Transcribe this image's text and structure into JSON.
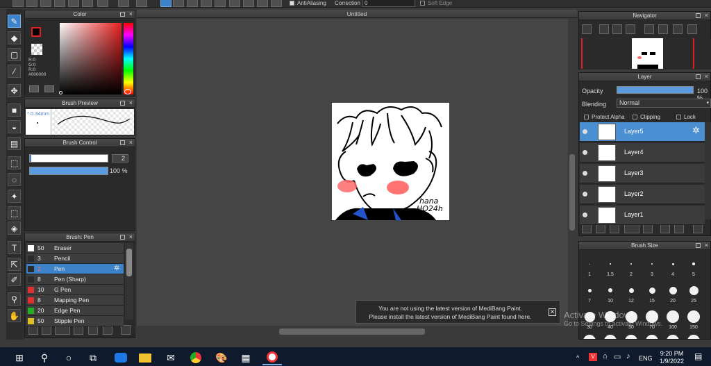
{
  "toolbar": {
    "antialiasing_label": "AntiAliasing",
    "correction_label": "Correction",
    "correction_value": "0",
    "soft_edge_label": "Soft Edge"
  },
  "canvas": {
    "title": "Untitled"
  },
  "color_panel": {
    "title": "Color",
    "r": "R:0",
    "g": "G:0",
    "b": "R:0",
    "hex": "#000000"
  },
  "brush_preview": {
    "title": "Brush Preview",
    "size": "0.34mm"
  },
  "brush_control": {
    "title": "Brush Control",
    "size_value": "2",
    "opacity_value": "100 %"
  },
  "brush_list": {
    "title": "Brush: Pen",
    "items": [
      {
        "size": "50",
        "name": "Eraser",
        "color": "#ffffff"
      },
      {
        "size": "3",
        "name": "Pencil",
        "color": "#2a2a2a"
      },
      {
        "size": "2",
        "name": "Pen",
        "color": "#2a2a2a"
      },
      {
        "size": "8",
        "name": "Pen (Sharp)",
        "color": "#2a2a2a"
      },
      {
        "size": "10",
        "name": "G Pen",
        "color": "#e03030"
      },
      {
        "size": "8",
        "name": "Mapping Pen",
        "color": "#e03030"
      },
      {
        "size": "20",
        "name": "Edge Pen",
        "color": "#22b022"
      },
      {
        "size": "50",
        "name": "Stipple Pen",
        "color": "#e0c020"
      }
    ]
  },
  "navigator": {
    "title": "Navigator"
  },
  "layer_panel": {
    "title": "Layer",
    "opacity_label": "Opacity",
    "opacity_value": "100 %",
    "blending_label": "Blending",
    "blending_value": "Normal",
    "protect_alpha": "Protect Alpha",
    "clipping": "Clipping",
    "lock": "Lock",
    "layers": [
      "Layer5",
      "Layer4",
      "Layer3",
      "Layer2",
      "Layer1"
    ]
  },
  "brush_size": {
    "title": "Brush Size",
    "labels": [
      "1",
      "1.5",
      "2",
      "3",
      "4",
      "5",
      "7",
      "10",
      "12",
      "15",
      "20",
      "25",
      "30",
      "40",
      "50",
      "70",
      "100",
      "150"
    ]
  },
  "notification": {
    "line1": "You are not using the latest version of MediBang Paint.",
    "line2": "Please install the latest version of MediBang Paint found here."
  },
  "watermark": {
    "line1": "Activate Windows",
    "line2": "Go to Settings to activate Windows."
  },
  "drawing": {
    "signature_line1": "hana",
    "signature_line2": "HO24h"
  },
  "taskbar": {
    "language": "ENG",
    "time": "9:20 PM",
    "date": "1/9/2022"
  },
  "colors": {
    "accent": "#3d83c9",
    "canvas_bg": "#454545",
    "panel_bg": "#2a2a2a",
    "taskbar": "#0f1b2d"
  }
}
